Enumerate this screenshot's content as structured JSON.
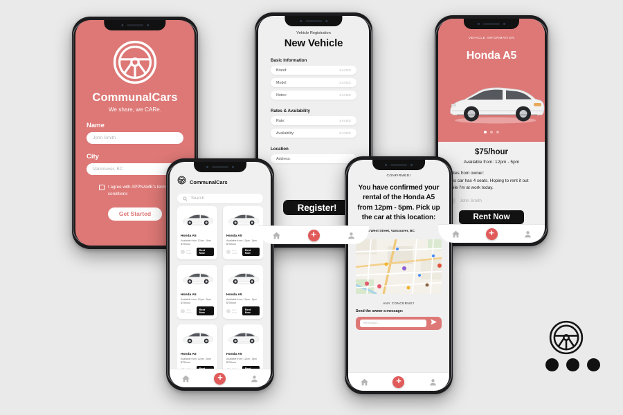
{
  "theme": {
    "coral": "#dd7876",
    "background": "#eaeaea",
    "dark": "#121212",
    "accent_red": "#e15b5b"
  },
  "signup_screen": {
    "brand": "CommunalCars",
    "tagline": "We share, we CARe.",
    "name_label": "Name",
    "name_value": "John Smith",
    "city_label": "City",
    "city_value": "Vancouver, BC",
    "terms_text": "I agree with APPNAME's terms and conditions",
    "cta": "Get Started"
  },
  "new_vehicle_screen": {
    "kicker": "Vehicle Registration",
    "title": "New Vehicle",
    "sections": [
      {
        "heading": "Basic Information",
        "fields": [
          {
            "label": "Brand:",
            "status": "SAVED"
          },
          {
            "label": "Model:",
            "status": "SAVED"
          },
          {
            "label": "Notes:",
            "status": "SAVED"
          }
        ]
      },
      {
        "heading": "Rates & Availability",
        "fields": [
          {
            "label": "Rate:",
            "status": "SAVED"
          },
          {
            "label": "Availability:",
            "status": "SAVED"
          }
        ]
      },
      {
        "heading": "Location",
        "fields": [
          {
            "label": "Address:",
            "status": ""
          }
        ]
      }
    ],
    "cta": "Register!"
  },
  "vehicle_info_screen": {
    "kicker": "VEHICLE INFORMATION",
    "car_name": "Honda A5",
    "price": "$75/hour",
    "availability": "Available from: 12pm - 5pm",
    "notes_label": "Notes from owner:",
    "notes_body": "This car has 4 seats. Hoping to rent it out while I'm at work today.",
    "owner": "John Smith",
    "cta": "Rent Now",
    "carousel_dots": 3,
    "carousel_active": 0
  },
  "browse_screen": {
    "app_title": "CommunalCars",
    "search_placeholder": "Search",
    "cards": [
      {
        "title": "Honda A5",
        "availability": "Available from: 12pm - 5pm",
        "price": "$75/hour",
        "owner": "John Smith",
        "cta": "Rent Now"
      },
      {
        "title": "Honda A5",
        "availability": "Available from: 12pm - 5pm",
        "price": "$75/hour",
        "owner": "John Smith",
        "cta": "Rent Now"
      },
      {
        "title": "Honda A5",
        "availability": "Available from: 12pm - 5pm",
        "price": "$75/hour",
        "owner": "John Smith",
        "cta": "Rent Now"
      },
      {
        "title": "Honda A5",
        "availability": "Available from: 12pm - 5pm",
        "price": "$75/hour",
        "owner": "John Smith",
        "cta": "Rent Now"
      },
      {
        "title": "Honda A5",
        "availability": "Available from: 12pm - 5pm",
        "price": "$75/hour",
        "owner": "John Smith",
        "cta": "Rent Now"
      },
      {
        "title": "Honda A5",
        "availability": "Available from: 12pm - 5pm",
        "price": "$75/hour",
        "owner": "John Smith",
        "cta": "Rent Now"
      }
    ]
  },
  "confirmed_screen": {
    "kicker": "CONFIRMED!",
    "message": "You have confirmed your rental of the Honda A5 from 12pm - 5pm. Pick up the car at this location:",
    "address": "1234 West Street, Vancouver, BC",
    "concerns_heading": "ANY CONCERNS?",
    "message_label": "Send the owner a message:",
    "message_placeholder": "Message..."
  },
  "tabbar": {
    "home": "home-icon",
    "add": "+",
    "profile": "profile-icon"
  }
}
